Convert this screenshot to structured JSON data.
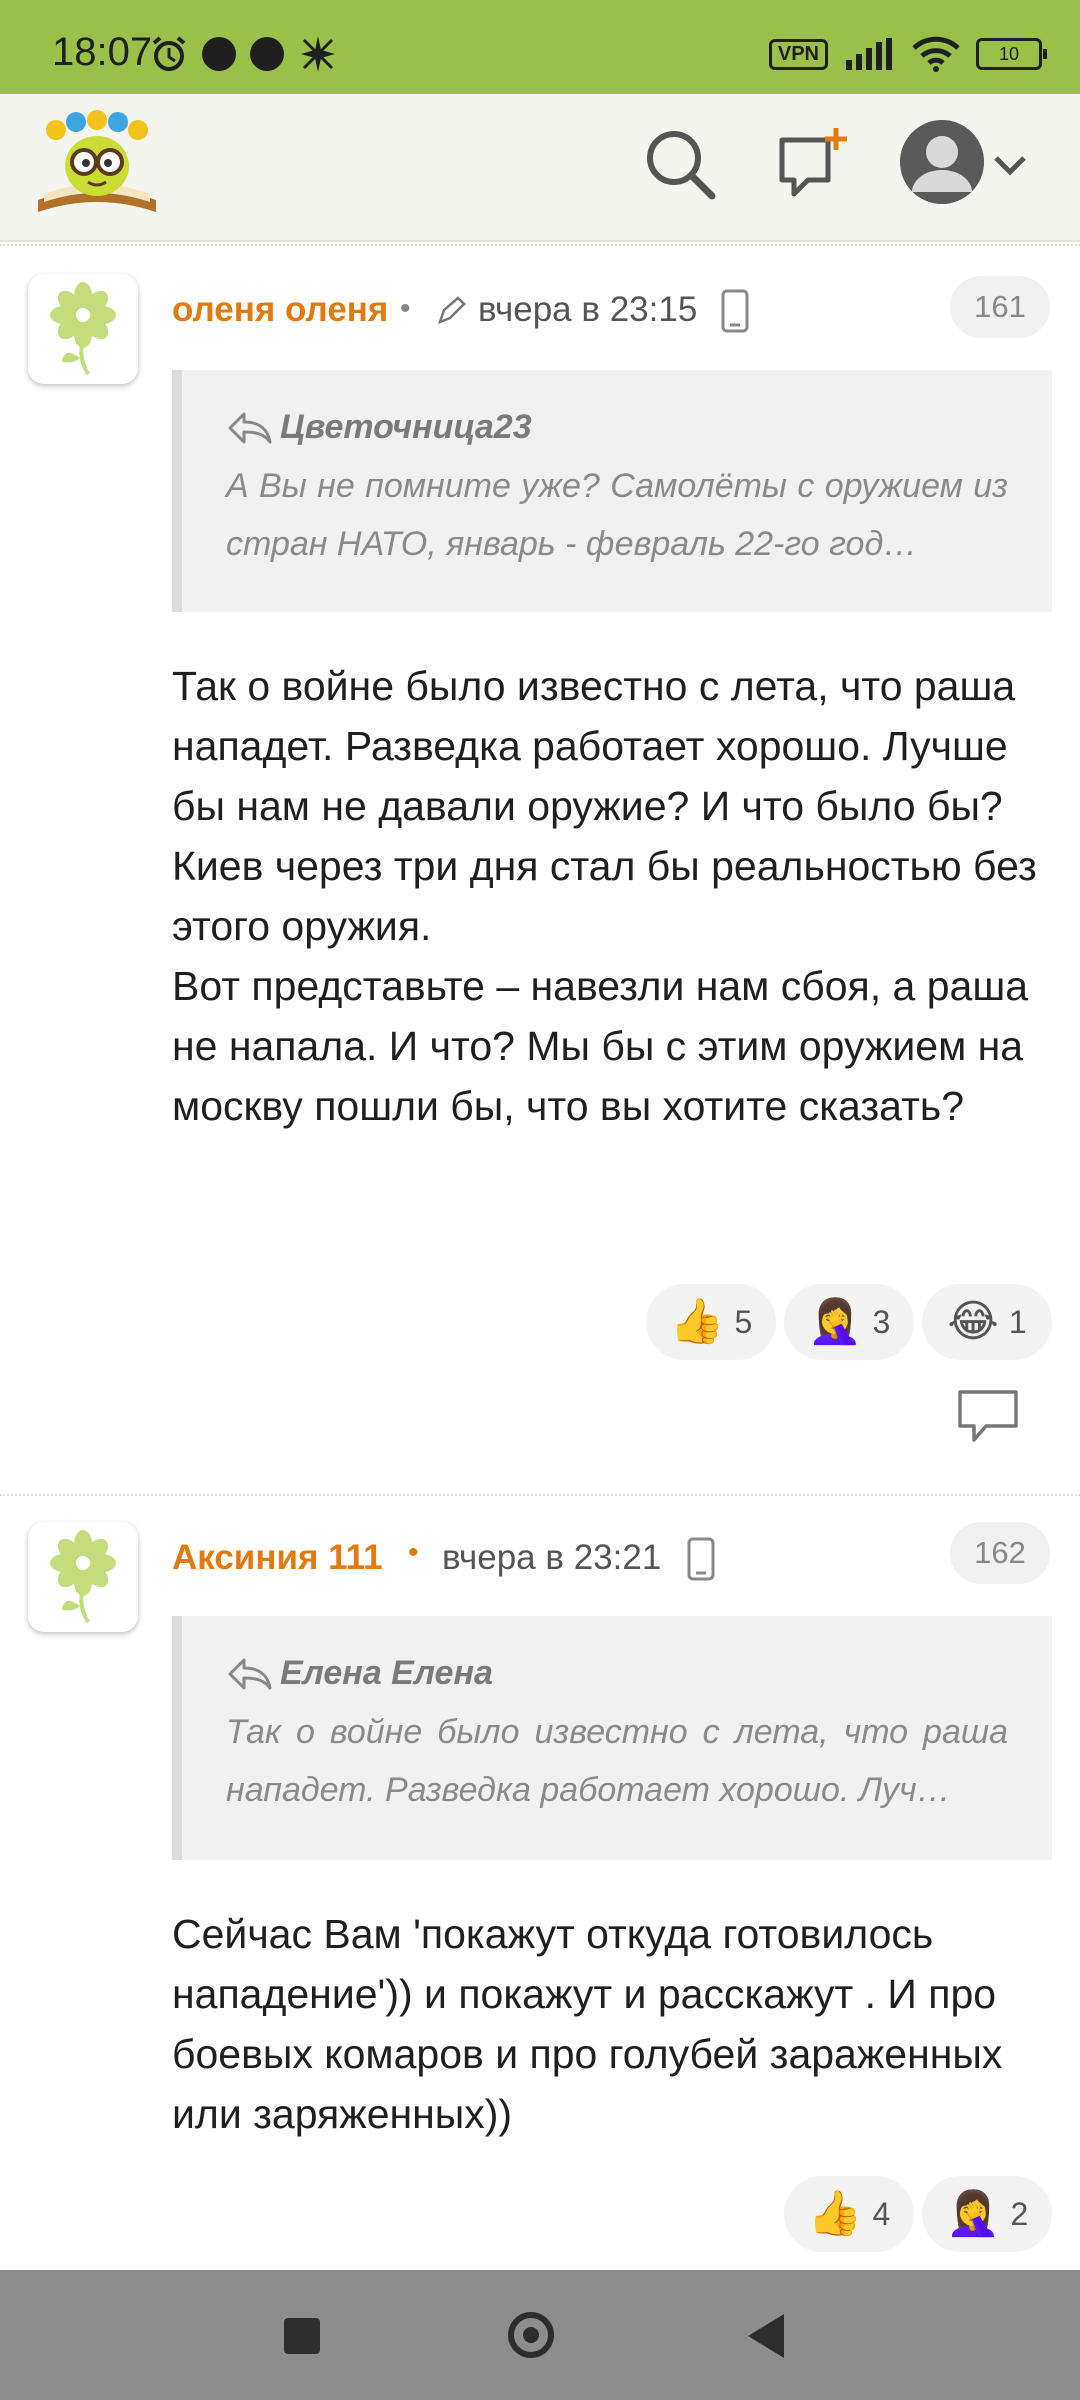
{
  "status_bar": {
    "time": "18:07",
    "vpn": "VPN",
    "battery": "10"
  },
  "comments": [
    {
      "author": "оленя оленя",
      "time": "вчера в 23:15",
      "number": "161",
      "quote_author": "Цветочница23",
      "quote_text": "А Вы не помните уже? Самолёты с оружием из стран НАТО, январь - февраль 22-го год…",
      "text": "Так о войне было известно с лета, что раша нападет. Разведка работает хорошо. Лучше бы нам не давали оружие? И что было бы? Киев через три дня стал бы реальностью без этого оружия.\nВот представьте – навезли нам сбоя, а раша не напала. И что? Мы бы с этим оружием на москву пошли бы, что вы хотите сказать?",
      "reactions": [
        {
          "emoji": "👍",
          "count": "5"
        },
        {
          "emoji": "🤦‍♀️",
          "count": "3"
        },
        {
          "emoji": "😂",
          "count": "1"
        }
      ]
    },
    {
      "author": "Аксиния 111",
      "time": "вчера в 23:21",
      "number": "162",
      "quote_author": "Елена Елена",
      "quote_text": "Так о войне было известно с лета, что раша нападет. Разведка работает хорошо. Луч…",
      "text": "Сейчас Вам 'покажут откуда готовилось нападение')) и покажут и расскажут . И про боевых комаров и про голубей зараженных или заряженных))",
      "reactions": [
        {
          "emoji": "👍",
          "count": "4"
        },
        {
          "emoji": "🤦‍♀️",
          "count": "2"
        }
      ]
    }
  ]
}
